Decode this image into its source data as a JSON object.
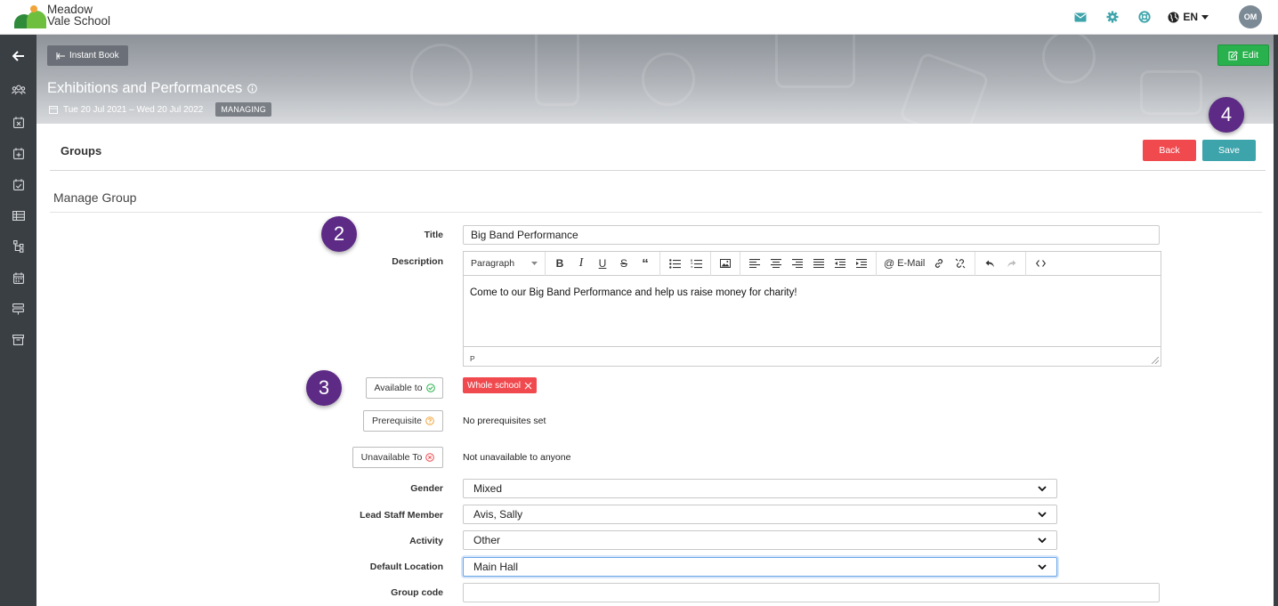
{
  "header": {
    "logo_line1": "Meadow",
    "logo_line2": "Vale School",
    "lang": "EN",
    "avatar": "OM",
    "icons": [
      "mail-icon",
      "gear-icon",
      "lifebuoy-icon",
      "globe-icon"
    ]
  },
  "sidebar": {
    "icons": [
      "back-arrow-icon",
      "users-icon",
      "calendar-x-icon",
      "calendar-plus-icon",
      "calendar-check-icon",
      "table-icon",
      "hierarchy-icon",
      "calendar-icon",
      "layers-icon",
      "archive-icon"
    ]
  },
  "banner": {
    "instant_book": "Instant Book",
    "title": "Exhibitions and Performances",
    "date_range": "Tue 20 Jul 2021 – Wed 20 Jul 2022",
    "badge": "MANAGING",
    "edit": "Edit"
  },
  "steps": {
    "s2": "2",
    "s3": "3",
    "s4": "4"
  },
  "groups": {
    "title": "Groups",
    "back": "Back",
    "save": "Save"
  },
  "manage": {
    "title": "Manage Group"
  },
  "form": {
    "title_label": "Title",
    "title_value": "Big Band Performance",
    "description_label": "Description",
    "editor": {
      "block_format": "Paragraph",
      "email": "E-Mail",
      "content": "Come to our Big Band Performance and help us raise money for charity!",
      "status": "P"
    },
    "available_to": "Available to",
    "available_tag": "Whole school",
    "prerequisite": "Prerequisite",
    "prerequisite_value": "No prerequisites set",
    "unavailable_to": "Unavailable To",
    "unavailable_value": "Not unavailable to anyone",
    "gender_label": "Gender",
    "gender_value": "Mixed",
    "lead_staff_label": "Lead Staff Member",
    "lead_staff_value": "Avis, Sally",
    "activity_label": "Activity",
    "activity_value": "Other",
    "location_label": "Default Location",
    "location_value": "Main Hall",
    "group_code_label": "Group code",
    "group_code_value": ""
  },
  "colors": {
    "primary_teal": "#3ea4ab",
    "danger_red": "#f04a4f",
    "success_green": "#28b14c",
    "sidebar_dark": "#3a3f44",
    "step_purple": "#5d2a86"
  }
}
